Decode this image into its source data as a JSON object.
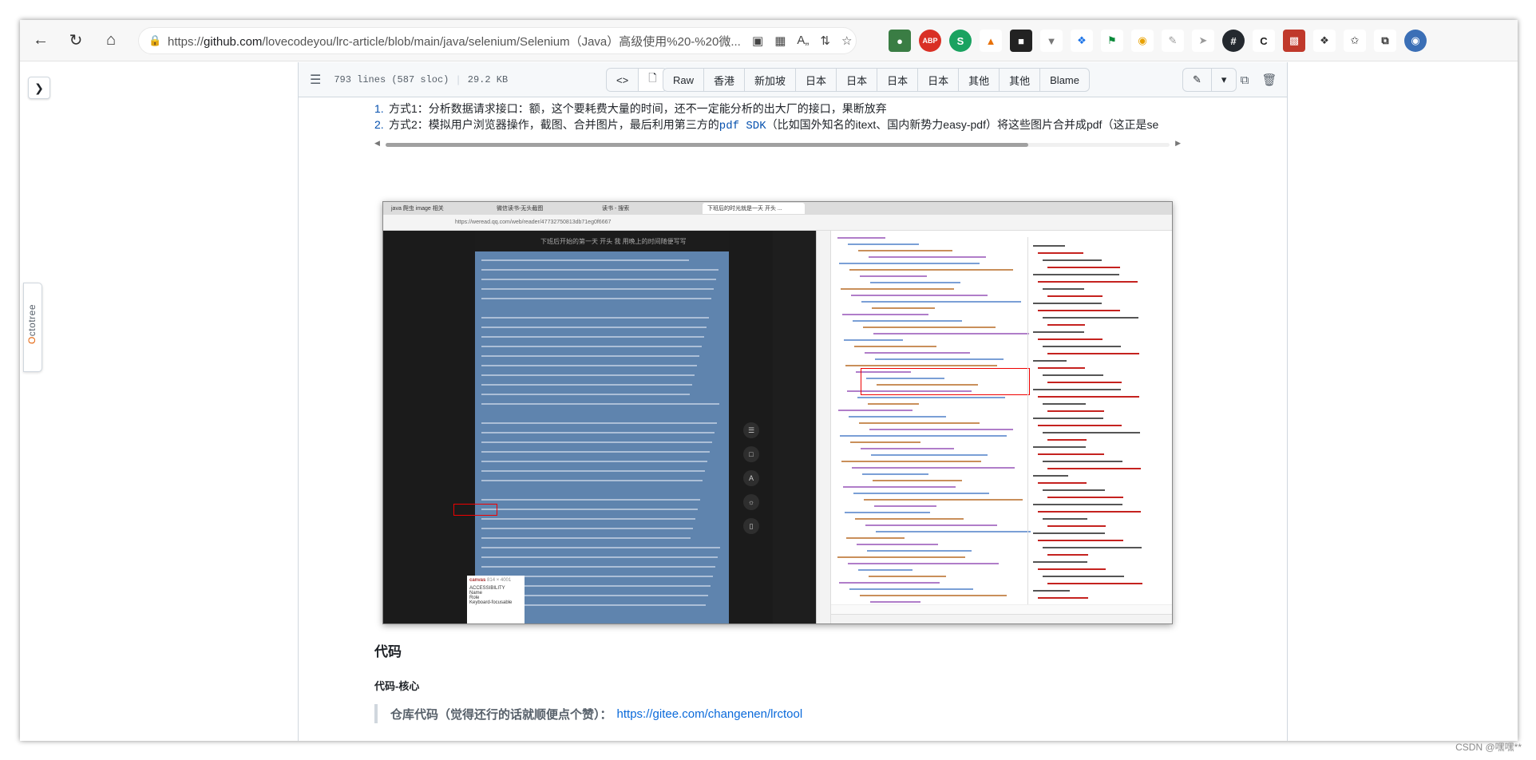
{
  "browser": {
    "url_prefix": "https://",
    "url_domain": "github.com",
    "url_path": "/lovecodeyou/lrc-article/blob/main/java/selenium/Selenium（Java）高级使用%20-%20微..."
  },
  "file_header": {
    "lines": "793 lines (587 sloc)",
    "size": "29.2 KB",
    "buttons": [
      "Raw",
      "香港",
      "新加坡",
      "日本",
      "日本",
      "日本",
      "日本",
      "其他",
      "其他",
      "Blame"
    ]
  },
  "list": [
    {
      "num": "1.",
      "text": "方式1：分析数据请求接口：额，这个要耗费大量的时间，还不一定能分析的出大厂的接口，果断放弃"
    },
    {
      "num": "2.",
      "text_a": "方式2：模拟用户浏览器操作，截图、合并图片，最后利用第三方的",
      "code": "pdf SDK",
      "text_b": "（比如国外知名的itext、国内新势力easy-pdf）将这些图片合并成pdf（这正是se"
    }
  ],
  "embedded": {
    "tab1": "java 爬虫 image 相关",
    "tab2": "微信读书-无头截图",
    "tab3": "读书 - 搜索",
    "tab4": "下班后的时光就是一天 开头 ...",
    "address": "https://weread.qq.com/web/reader/47732750813db71eg0f6667",
    "reader_header": "下班后开始的第一天 开头 我 用晚上的时间随便写写",
    "canvas_label": "canvas",
    "canvas_size": "814 × 4001",
    "tip_accessibility": "ACCESSIBILITY",
    "tip_name": "Name",
    "tip_role": "Role",
    "tip_keyboard": "Keyboard-focusable"
  },
  "headings": {
    "code": "代码",
    "core": "代码-核心"
  },
  "quote": {
    "label": "仓库代码（觉得还行的话就顺便点个赞）：",
    "link": "https://gitee.com/changenen/lrctool"
  },
  "octotree": {
    "brand_o": "O",
    "brand_rest": "ctotree"
  },
  "watermark": "CSDN @嘿嘿**"
}
